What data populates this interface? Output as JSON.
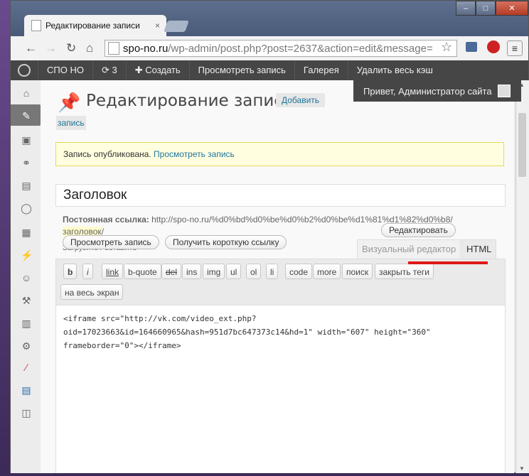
{
  "browser": {
    "tab_title": "Редактирование записи",
    "tab_close": "×",
    "url_host": "spo-no.ru",
    "url_path": "/wp-admin/post.php?post=2637&action=edit&message=",
    "menu_glyph": "≡"
  },
  "window_controls": {
    "minimize": "–",
    "maximize": "□",
    "close": "✕"
  },
  "adminbar": {
    "items": [
      "СПО НО",
      "3",
      "Создать",
      "Просмотреть запись",
      "Галерея",
      "Удалить весь кэш"
    ],
    "greeting": "Привет, Администратор сайта"
  },
  "page": {
    "heading": "Редактирование записи",
    "add_button_part1": "Добавить",
    "add_button_part2": "запись",
    "notice_text": "Запись опубликована.",
    "notice_link": "Просмотреть запись",
    "title_value": "Заголовок",
    "permalink_label": "Постоянная ссылка:",
    "permalink_prefix": "http://spo-no.ru/%d0%bd%d0%be%d0%b2%d0%be%d1%81%d1%82%d0%b8/",
    "permalink_slug": "заголовок",
    "permalink_suffix": "/",
    "edit_button": "Редактировать",
    "view_button": "Просмотреть запись",
    "shortlink_button": "Получить короткую ссылку",
    "upload_label": "Загрузить / вставить",
    "tab_visual": "Визуальный редактор",
    "tab_html": "HTML"
  },
  "quicktags": [
    "b",
    "i",
    "link",
    "b-quote",
    "del",
    "ins",
    "img",
    "ul",
    "ol",
    "li",
    "code",
    "more",
    "поиск",
    "закрыть теги",
    "на весь экран"
  ],
  "editor": {
    "content_line1": "<iframe src=\"http://vk.com/video_ext.php?",
    "content_line2": "oid=17023663&id=164660965&hash=951d7bc647373c14&hd=1\" width=\"607\" height=\"360\"",
    "content_line3": "frameborder=\"0\"></iframe>"
  },
  "colors": {
    "adminbar": "#464646",
    "link": "#21759b",
    "notice_bg": "#ffffe0",
    "annotation": "#e01818"
  }
}
